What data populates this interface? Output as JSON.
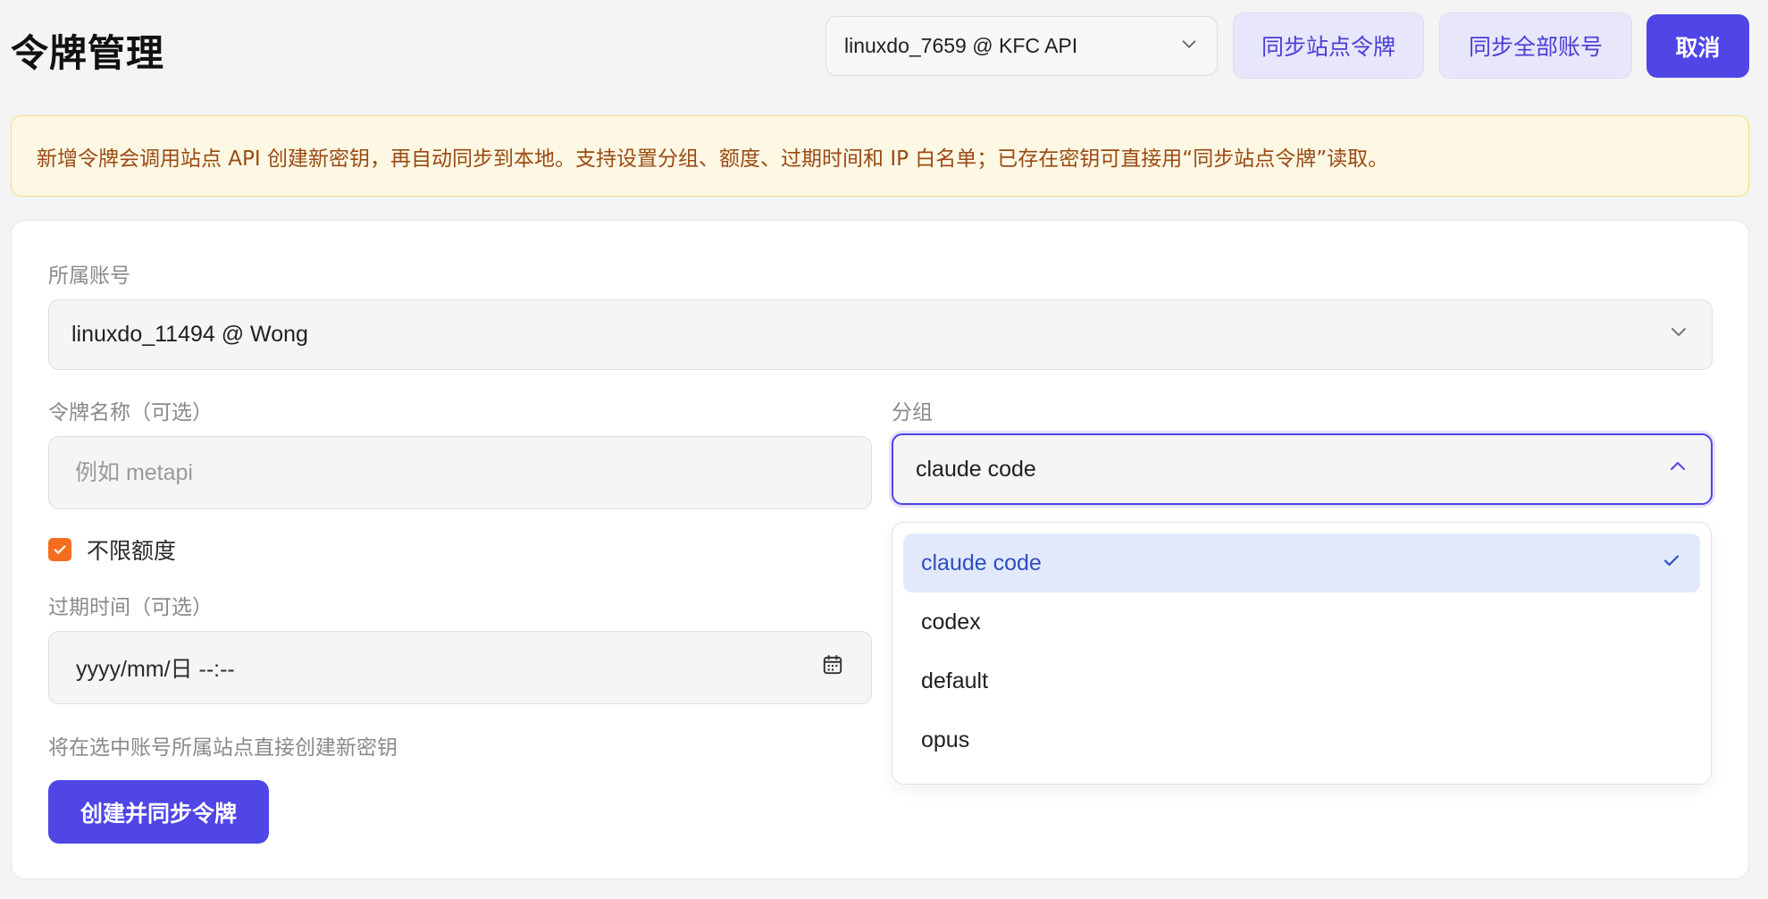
{
  "header": {
    "title": "令牌管理",
    "account_selector_value": "linuxdo_7659 @ KFC API",
    "sync_site_tokens_label": "同步站点令牌",
    "sync_all_accounts_label": "同步全部账号",
    "cancel_label": "取消"
  },
  "notice": {
    "text": "新增令牌会调用站点 API 创建新密钥，再自动同步到本地。支持设置分组、额度、过期时间和 IP 白名单；已存在密钥可直接用“同步站点令牌”读取。"
  },
  "form": {
    "owner_label": "所属账号",
    "owner_value": "linuxdo_11494 @ Wong",
    "name_label": "令牌名称（可选）",
    "name_placeholder": "例如 metapi",
    "name_value": "",
    "group_label": "分组",
    "group_value": "claude code",
    "unlimited_label": "不限额度",
    "unlimited_checked": true,
    "expiry_label": "过期时间（可选）",
    "expiry_placeholder": "yyyy/mm/日 --:--",
    "hint": "将在选中账号所属站点直接创建新密钥",
    "create_label": "创建并同步令牌"
  },
  "dropdown": {
    "options": [
      {
        "label": "claude code",
        "selected": true
      },
      {
        "label": "codex",
        "selected": false
      },
      {
        "label": "default",
        "selected": false
      },
      {
        "label": "opus",
        "selected": false
      }
    ]
  },
  "colors": {
    "primary": "#4f46e5",
    "checkbox": "#f56d1f",
    "notice_bg": "#fdf8e4",
    "notice_text": "#9a4a12"
  },
  "icons": {
    "select_chevron": "chevron-down-icon",
    "group_chevron": "chevron-up-icon",
    "checked": "check-icon",
    "calendar": "calendar-icon"
  }
}
